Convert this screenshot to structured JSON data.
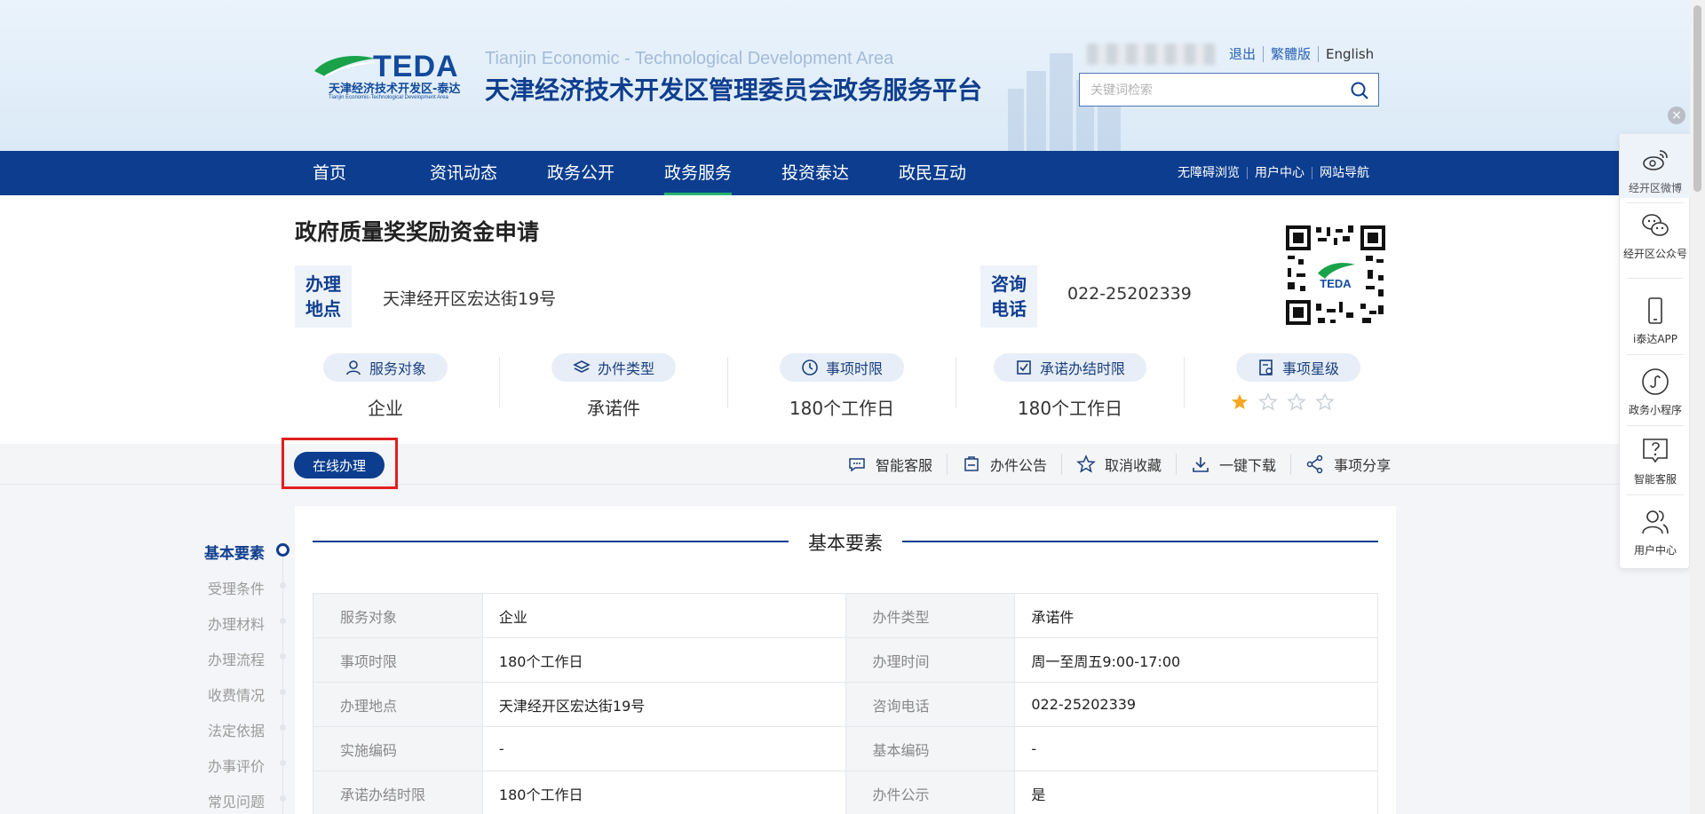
{
  "header": {
    "logo_brand": "TEDA",
    "logo_cn": "天津经济技术开发区-泰达",
    "logo_en": "Tianjin Economic-Technological Development Area",
    "site_en": "Tianjin Economic - Technological Development Area",
    "site_cn": "天津经济技术开发区管理委员会政务服务平台",
    "links": {
      "logout": "退出",
      "traditional": "繁體版",
      "english": "English"
    },
    "search_placeholder": "关键词检索"
  },
  "nav": {
    "items": [
      "首页",
      "资讯动态",
      "政务公开",
      "政务服务",
      "投资泰达",
      "政民互动"
    ],
    "active": "政务服务",
    "right_links": [
      "无障碍浏览",
      "用户中心",
      "网站导航"
    ]
  },
  "item": {
    "title": "政府质量奖奖励资金申请",
    "location_label": "办理地点",
    "location_label_l1": "办理",
    "location_label_l2": "地点",
    "location": "天津经开区宏达街19号",
    "phone_label_l1": "咨询",
    "phone_label_l2": "电话",
    "phone": "022-25202339",
    "qr_text": "TEDA",
    "stats": [
      {
        "label": "服务对象",
        "value": "企业",
        "icon": "users-icon"
      },
      {
        "label": "办件类型",
        "value": "承诺件",
        "icon": "layers-icon"
      },
      {
        "label": "事项时限",
        "value": "180个工作日",
        "icon": "clock-icon"
      },
      {
        "label": "承诺办结时限",
        "value": "180个工作日",
        "icon": "checklist-icon"
      },
      {
        "label": "事项星级",
        "value": "",
        "icon": "star-list-icon"
      }
    ],
    "star_rating": 1,
    "star_max": 4
  },
  "actions": {
    "online": "在线办理",
    "items": [
      {
        "label": "智能客服",
        "icon": "chat-icon"
      },
      {
        "label": "办件公告",
        "icon": "notice-icon"
      },
      {
        "label": "取消收藏",
        "icon": "star-outline-icon"
      },
      {
        "label": "一键下载",
        "icon": "download-icon"
      },
      {
        "label": "事项分享",
        "icon": "share-icon"
      }
    ]
  },
  "anchors": [
    "基本要素",
    "受理条件",
    "办理材料",
    "办理流程",
    "收费情况",
    "法定依据",
    "办事评价",
    "常见问题"
  ],
  "basic": {
    "title": "基本要素",
    "rows": [
      [
        "服务对象",
        "企业",
        "办件类型",
        "承诺件"
      ],
      [
        "事项时限",
        "180个工作日",
        "办理时间",
        "周一至周五9:00-17:00"
      ],
      [
        "办理地点",
        "天津经开区宏达街19号",
        "咨询电话",
        "022-25202339"
      ],
      [
        "实施编码",
        "-",
        "基本编码",
        "-"
      ],
      [
        "承诺办结时限",
        "180个工作日",
        "办件公示",
        "是"
      ]
    ]
  },
  "float_sidebar": [
    {
      "label": "经开区微博",
      "icon": "weibo-icon"
    },
    {
      "label": "经开区公众号",
      "icon": "wechat-icon"
    },
    {
      "label": "i泰达APP",
      "icon": "mobile-icon"
    },
    {
      "label": "政务小程序",
      "icon": "mini-program-icon"
    },
    {
      "label": "智能客服",
      "icon": "help-icon"
    },
    {
      "label": "用户中心",
      "icon": "user-group-icon"
    }
  ],
  "colors": {
    "primary": "#0c3d8f",
    "accent_green": "#26b36c",
    "highlight_red": "#e21f1f",
    "star": "#f5a623"
  }
}
